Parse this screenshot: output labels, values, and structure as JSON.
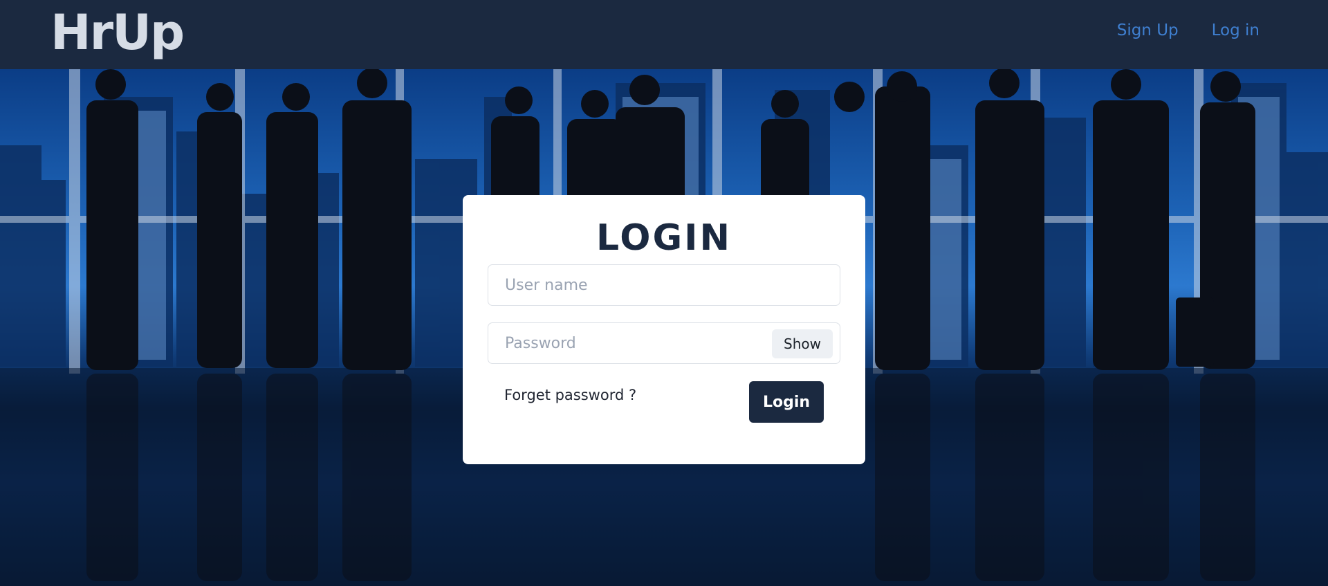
{
  "navbar": {
    "brand": "HrUp",
    "links": [
      {
        "label": "Sign Up"
      },
      {
        "label": "Log in"
      }
    ]
  },
  "login_card": {
    "title": "LOGIN",
    "username_placeholder": "User name",
    "username_value": "",
    "password_placeholder": "Password",
    "password_value": "",
    "show_label": "Show",
    "forgot_label": "Forget password ?",
    "submit_label": "Login"
  },
  "colors": {
    "navbar_bg": "#1b2940",
    "brand": "#d6dce6",
    "nav_link": "#3f7fd0",
    "card_bg": "#ffffff",
    "button_bg": "#1b2940"
  },
  "background": {
    "description_icon": "business-people-silhouettes-city-skyline"
  }
}
